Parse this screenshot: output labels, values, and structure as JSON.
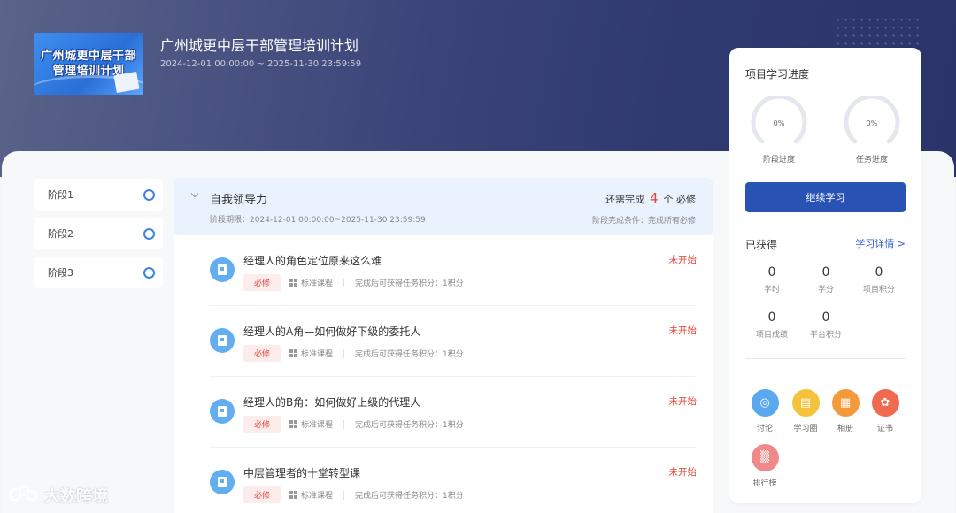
{
  "project": {
    "cover_line1": "广州城更中层干部",
    "cover_line2": "管理培训计划",
    "title": "广州城更中层干部管理培训计划",
    "date_range": "2024-12-01 00:00:00 ~ 2025-11-30 23:59:59"
  },
  "stages": [
    {
      "label": "阶段1"
    },
    {
      "label": "阶段2"
    },
    {
      "label": "阶段3"
    }
  ],
  "current_stage": {
    "name": "自我领导力",
    "period": "阶段期限：2024-12-01 00:00:00~2025-11-30 23:59:59",
    "remain_prefix": "还需完成",
    "remain_count": "4",
    "remain_suffix": "个 必修",
    "condition": "阶段完成条件：完成所有必修"
  },
  "courses": [
    {
      "title": "经理人的角色定位原来这么难",
      "status": "未开始",
      "tag": "必修",
      "type": "标准课程",
      "points": "完成后可获得任务积分：1积分"
    },
    {
      "title": "经理人的A角—如何做好下级的委托人",
      "status": "未开始",
      "tag": "必修",
      "type": "标准课程",
      "points": "完成后可获得任务积分：1积分"
    },
    {
      "title": "经理人的B角：如何做好上级的代理人",
      "status": "未开始",
      "tag": "必修",
      "type": "标准课程",
      "points": "完成后可获得任务积分：1积分"
    },
    {
      "title": "中层管理者的十堂转型课",
      "status": "未开始",
      "tag": "必修",
      "type": "标准课程",
      "points": "完成后可获得任务积分：1积分"
    }
  ],
  "progress": {
    "heading": "项目学习进度",
    "stage_pct": "0%",
    "stage_label": "阶段进度",
    "task_pct": "0%",
    "task_label": "任务进度",
    "continue_label": "继续学习"
  },
  "earned": {
    "heading": "已获得",
    "detail_link": "学习详情 >",
    "stats": [
      {
        "value": "0",
        "label": "学时"
      },
      {
        "value": "0",
        "label": "学分"
      },
      {
        "value": "0",
        "label": "项目积分"
      },
      {
        "value": "0",
        "label": "项目成绩"
      },
      {
        "value": "0",
        "label": "平台积分"
      }
    ]
  },
  "apps": [
    {
      "label": "讨论",
      "icon": "chat-icon",
      "color": "#5aa9f0"
    },
    {
      "label": "学习圈",
      "icon": "note-icon",
      "color": "#f5c23c"
    },
    {
      "label": "相册",
      "icon": "image-icon",
      "color": "#f59a3b"
    },
    {
      "label": "证书",
      "icon": "badge-icon",
      "color": "#f06a4f"
    },
    {
      "label": "排行榜",
      "icon": "chart-icon",
      "color": "#f08a8a"
    }
  ],
  "watermark": "大数跨境",
  "colors": {
    "primary": "#2853b5",
    "status": "#e0463a",
    "ring": "#3d84e0"
  }
}
